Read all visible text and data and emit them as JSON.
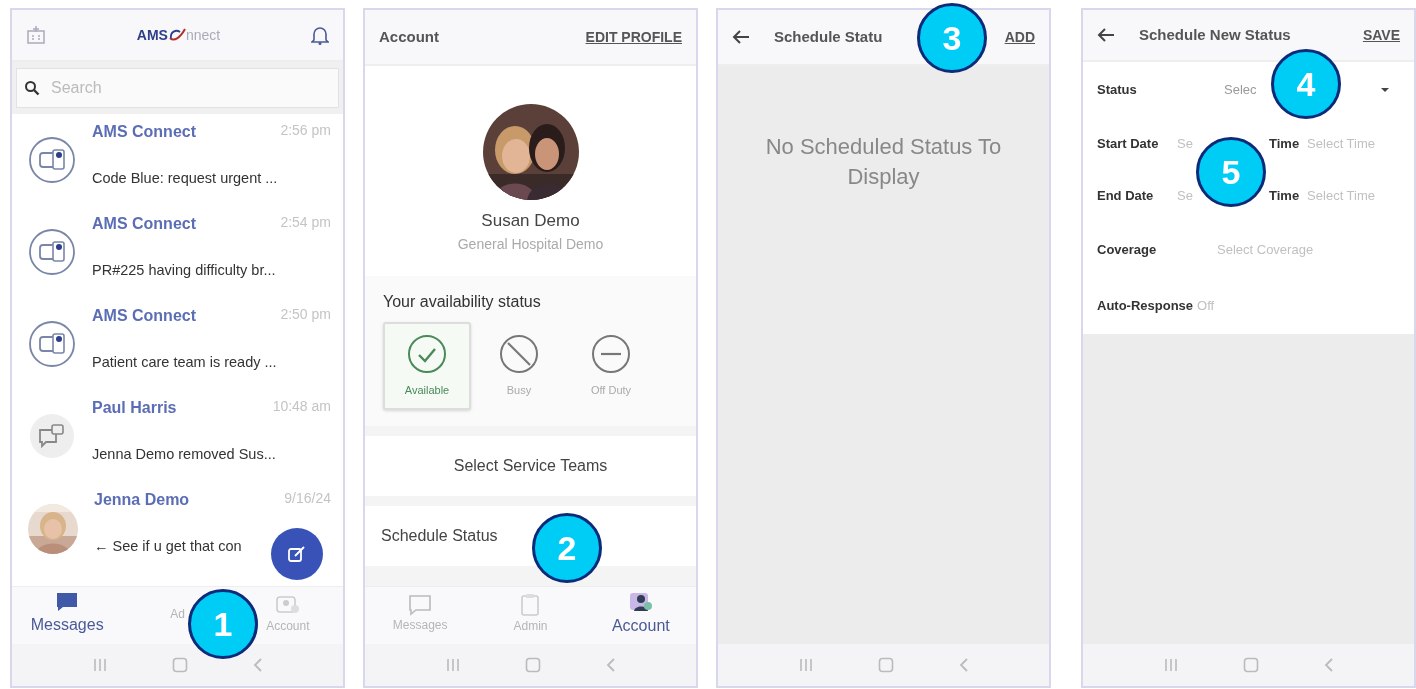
{
  "panels": [
    {
      "kind": "messages",
      "step": "1",
      "logo": {
        "bold": "AMS",
        "rest": "nnect"
      },
      "search": {
        "placeholder": "Search"
      },
      "messages": [
        {
          "sender": "AMS Connect",
          "time": "2:56 pm",
          "preview": "Code Blue: request urgent ...",
          "kind": "group"
        },
        {
          "sender": "AMS Connect",
          "time": "2:54 pm",
          "preview": "PR#225 having difficulty br...",
          "kind": "group"
        },
        {
          "sender": "AMS Connect",
          "time": "2:50 pm",
          "preview": "Patient care team is ready ...",
          "kind": "group"
        },
        {
          "sender": "Paul Harris",
          "time": "10:48 am",
          "preview": "Jenna Demo removed Sus...",
          "kind": "chat"
        },
        {
          "sender": "Jenna Demo",
          "time": "9/16/24",
          "preview": "← See if u get that con",
          "kind": "picture"
        }
      ],
      "nav": [
        {
          "label": "Messages",
          "selected": true
        },
        {
          "label": "Ad",
          "selected": false
        },
        {
          "label": "Account",
          "selected": false
        }
      ]
    },
    {
      "kind": "account",
      "step": "2",
      "title": "Account",
      "action": "EDIT PROFILE",
      "profile": {
        "name": "Susan Demo",
        "organization": "General Hospital Demo"
      },
      "availability": {
        "title": "Your availability status",
        "options": [
          {
            "label": "Available",
            "kind": "available",
            "selected": true
          },
          {
            "label": "Busy",
            "kind": "busy",
            "selected": false
          },
          {
            "label": "Off Duty",
            "kind": "off",
            "selected": false
          }
        ]
      },
      "links": [
        {
          "label": "Select Service Teams",
          "kind": "center"
        },
        {
          "label": "Schedule Status",
          "kind": "left"
        }
      ],
      "nav": [
        {
          "label": "Messages",
          "selected": false
        },
        {
          "label": "Admin",
          "selected": false
        },
        {
          "label": "Account",
          "selected": true
        }
      ]
    },
    {
      "kind": "schedule-list",
      "step": "3",
      "title": "Schedule Statu",
      "action": "ADD",
      "empty": "No Scheduled Status To Display"
    },
    {
      "kind": "schedule-form",
      "step": "4",
      "step2": "5",
      "title": "Schedule New Status",
      "action": "SAVE",
      "fields": [
        {
          "kind": "dropdown",
          "label": "Status",
          "value": "Selec"
        },
        {
          "kind": "datetime",
          "label": "Start Date",
          "value": "Se",
          "time_label": "Time",
          "time_value": "Select Time"
        },
        {
          "kind": "datetime",
          "label": "End Date",
          "value": "Se",
          "time_label": "Time",
          "time_value": "Select Time"
        },
        {
          "kind": "text",
          "label": "Coverage",
          "value": "Select Coverage"
        },
        {
          "kind": "inline",
          "label": "Auto-Response",
          "value": "Off"
        }
      ]
    }
  ]
}
